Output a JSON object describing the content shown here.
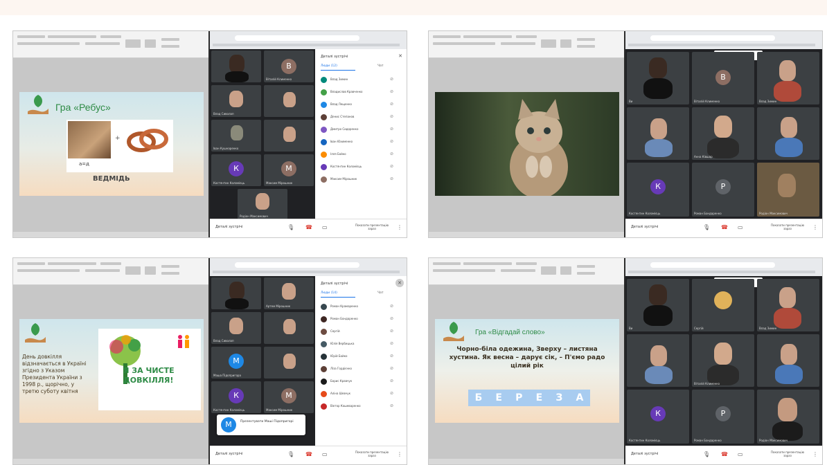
{
  "panels": [
    {
      "slide": {
        "title": "Гра «Ребус»",
        "caption": "а=д",
        "answer": "ВЕДМІДЬ"
      },
      "meet": {
        "details_title": "Деталі зустрічі",
        "tab_people": "Люди (12)",
        "tab_chat": "Чат",
        "participants": [
          "Влад Зимин",
          "Владислав Кравченко",
          "Влад Лещенко",
          "Денис Степанов",
          "Дмитро Сидоренко",
          "Іван Юхименко",
          "Ілля Бойко",
          "Костянтин Коломієць",
          "Максим Мірошник"
        ],
        "tiles": [
          "",
          "Віталій Клименко",
          "Влад Сиволап",
          "",
          "Іван Кушнаренко",
          "",
          "Костянтин Коломієць",
          "Максим Мірошник",
          "Родіон Максимович"
        ],
        "avatars": [
          "В",
          "К",
          "М"
        ],
        "bar_label": "Деталі зустрічі",
        "present_label": "Показати презентацію зараз"
      }
    },
    {
      "meet": {
        "tiles": [
          "Ви",
          "Віталій Клименко",
          "Влад Зимин",
          "",
          "Анна Ківшар",
          "",
          "Костянтин Коломієць",
          "Роман Бондаренко",
          "Родіон Максимович"
        ],
        "avatars": [
          "В",
          "К",
          "Р"
        ],
        "bar_label": "Деталі зустрічі",
        "present_label": "Показати презентацію зараз",
        "notice": "Євгенія Сергі... Гість 13"
      }
    },
    {
      "slide": {
        "text": "День довкілля відзначається в Україні згідно з Указом Президента України з 1998 р., щорічно, у третю суботу квітня",
        "poster": "Я ЗА ЧИСТЕ ДОВКІЛЛЯ!"
      },
      "meet": {
        "details_title": "Деталі зустрічі",
        "tab_people": "Люди (14)",
        "tab_chat": "Чат",
        "participants": [
          "Роман Крамаренко",
          "Роман Бондаренко",
          "Сергій",
          "Юлія Вербицька",
          "Юрій Бойко",
          "Ліза Гордієнко",
          "Борис Кравчук",
          "Аліна Шевчук",
          "Віктор Кошеваренко"
        ],
        "tiles": [
          "",
          "Артем Мірошник",
          "Влад Сиволап",
          "",
          "Маша Підопригора",
          "",
          "Костянтин Коломієць",
          "Максим Мірошник"
        ],
        "avatars": [
          "М",
          "К",
          "М"
        ],
        "popup": "Презентувати Маші Підопригорі",
        "popup_avatar": "М",
        "bar_label": "Деталі зустрічі",
        "present_label": "Показати презентацію зараз"
      }
    },
    {
      "slide": {
        "title": "Гра «Відгадай слово»",
        "riddle": "Чорно-біла одежина, Зверху – листяна хустина. Як весна – дарує сік, – П'ємо радо цілий рік",
        "answer_letters": [
          "Б",
          "Е",
          "Р",
          "Е",
          "З",
          "А"
        ]
      },
      "meet": {
        "tiles": [
          "Ви",
          "Сергій",
          "Влад Зимин",
          "",
          "Віталій Клименко",
          "",
          "Костянтин Коломієць",
          "Роман Бондаренко",
          "Родіон Максимович"
        ],
        "avatars": [
          "К",
          "Р"
        ],
        "bar_label": "Деталі зустрічі",
        "present_label": "Показати презентацію зараз",
        "notice": "Іван Юхименко Гість 13"
      }
    }
  ],
  "colors": {
    "meet_bg": "#202124",
    "avatar_purple": "#673ab7",
    "avatar_brown": "#8d6e63",
    "avatar_blue": "#1e88e5",
    "avatar_gray": "#5f6368",
    "slide_green": "#2e8b46"
  }
}
